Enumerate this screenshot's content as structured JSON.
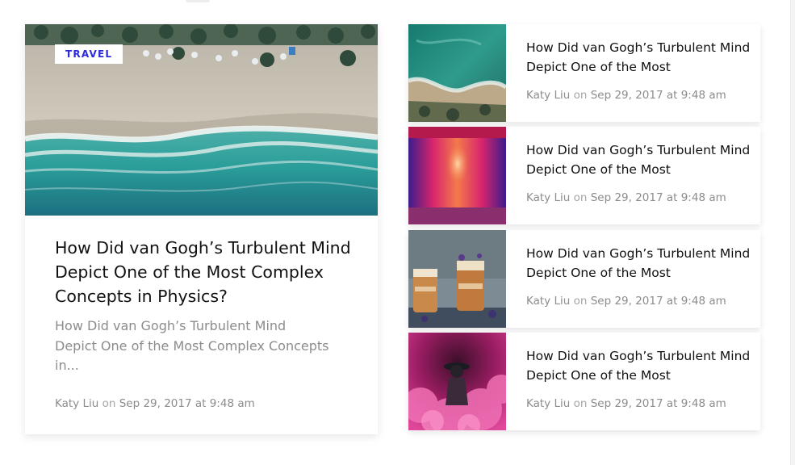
{
  "featured": {
    "category": "TRAVEL",
    "title": "How Did van Gogh’s Turbulent Mind Depict One of the Most Complex Concepts in Physics?",
    "excerpt": "How Did van Gogh’s Turbulent Mind Depict One of the Most Complex Concepts in...",
    "author": "Katy Liu",
    "on": "on",
    "date": "Sep 29, 2017 at 9:48 am"
  },
  "posts": [
    {
      "title": "How Did van Gogh’s Turbulent Mind Depict One of the Most",
      "author": "Katy Liu",
      "on": "on",
      "date": "Sep 29, 2017 at 9:48 am"
    },
    {
      "title": "How Did van Gogh’s Turbulent Mind Depict One of the Most",
      "author": "Katy Liu",
      "on": "on",
      "date": "Sep 29, 2017 at 9:48 am"
    },
    {
      "title": "How Did van Gogh’s Turbulent Mind Depict One of the Most",
      "author": "Katy Liu",
      "on": "on",
      "date": "Sep 29, 2017 at 9:48 am"
    },
    {
      "title": "How Did van Gogh’s Turbulent Mind Depict One of the Most",
      "author": "Katy Liu",
      "on": "on",
      "date": "Sep 29, 2017 at 9:48 am"
    }
  ]
}
